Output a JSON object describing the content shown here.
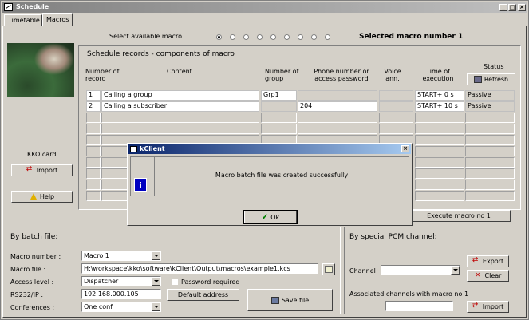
{
  "window": {
    "title": "Schedule"
  },
  "tabs": [
    {
      "label": "Timetable"
    },
    {
      "label": "Macros"
    }
  ],
  "macro_select": {
    "label": "Select available macro",
    "selected_index": 0,
    "selected_text": "Selected macro number 1"
  },
  "card": {
    "label": "KKO card",
    "import_label": "Import",
    "help_label": "Help"
  },
  "records": {
    "title": "Schedule records - components of macro",
    "headers": {
      "number": "Number of record",
      "content": "Content",
      "group": "Number of group",
      "phone": "Phone number or access password",
      "voice": "Voice ann.",
      "time": "Time of execution",
      "status": "Status"
    },
    "refresh_label": "Refresh",
    "rows": [
      {
        "number": "1",
        "content": "Calling a group",
        "group": "Grp1",
        "phone": "",
        "voice": "",
        "time": "START+ 0 s",
        "status": "Passive"
      },
      {
        "number": "2",
        "content": "Calling a subscriber",
        "group": "",
        "phone": "204",
        "voice": "",
        "time": "START+ 10 s",
        "status": "Passive"
      }
    ],
    "execute_label": "Execute macro no 1"
  },
  "batch": {
    "title": "By batch file:",
    "macro_number_label": "Macro number :",
    "macro_number_value": "Macro 1",
    "macro_file_label": "Macro file :",
    "macro_file_value": "H:\\workspace\\kko\\software\\kClient\\Output\\macros\\example1.kcs",
    "access_level_label": "Access level :",
    "access_level_value": "Dispatcher",
    "password_required_label": "Password required",
    "rs232_label": "RS232/IP :",
    "rs232_value": "192.168.000.105",
    "default_address_label": "Default address",
    "conferences_label": "Conferences :",
    "conferences_value": "One conf",
    "save_label": "Save file"
  },
  "pcm": {
    "title": "By special PCM channel:",
    "channel_label": "Channel",
    "channel_value": "",
    "export_label": "Export",
    "clear_label": "Clear",
    "associated_label": "Associated channels with macro no 1",
    "associated_value": "",
    "import_label": "Import"
  },
  "dialog": {
    "title": "kClient",
    "message": "Macro batch file was created successfully",
    "ok_label": "Ok"
  },
  "colors": {
    "dialog_title_start": "#0a246a",
    "dialog_title_end": "#a6caf0",
    "ok_icon": "#008000",
    "info_icon": "#0000c0"
  }
}
